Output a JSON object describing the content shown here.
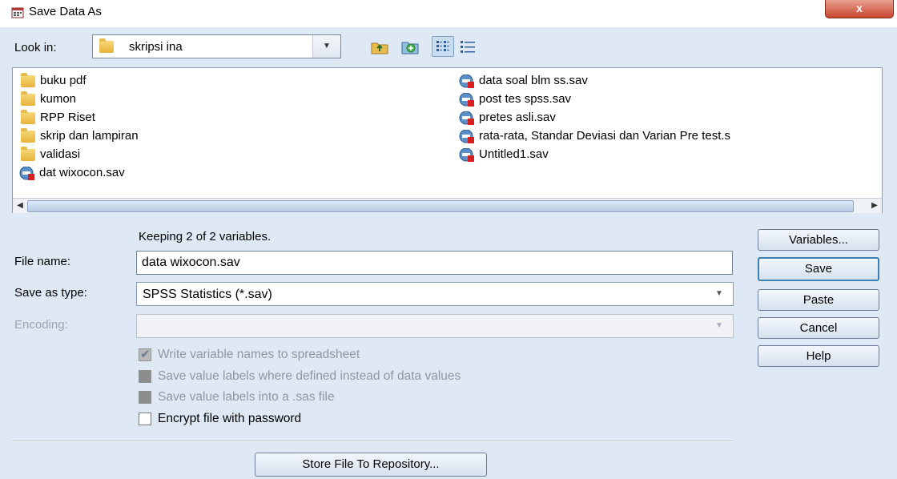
{
  "window": {
    "title": "Save Data As",
    "close_glyph": "x"
  },
  "lookin": {
    "label": "Look in:",
    "value": "skripsi ina"
  },
  "toolbar": [
    "up-one-level-icon",
    "new-folder-icon",
    "list-view-icon",
    "details-view-icon"
  ],
  "files_col1": [
    {
      "name": "buku pdf",
      "icon": "folder-icon"
    },
    {
      "name": "kumon",
      "icon": "folder-icon"
    },
    {
      "name": "RPP Riset",
      "icon": "folder-icon"
    },
    {
      "name": "skrip dan lampiran",
      "icon": "folder-icon"
    },
    {
      "name": "validasi",
      "icon": "folder-icon"
    },
    {
      "name": "dat wixocon.sav",
      "icon": "sav-file-icon"
    }
  ],
  "files_col2": [
    {
      "name": "data soal blm ss.sav",
      "icon": "sav-file-icon"
    },
    {
      "name": "post tes spss.sav",
      "icon": "sav-file-icon"
    },
    {
      "name": "pretes asli.sav",
      "icon": "sav-file-icon"
    },
    {
      "name": "rata-rata, Standar Deviasi dan Varian Pre test.s",
      "icon": "sav-file-icon"
    },
    {
      "name": "Untitled1.sav",
      "icon": "sav-file-icon"
    }
  ],
  "form": {
    "keeping": "Keeping 2 of 2 variables.",
    "file_name_label": "File name:",
    "file_name_value": "data wixocon.sav",
    "save_type_label": "Save as type:",
    "save_type_value": "SPSS Statistics (*.sav)",
    "encoding_label": "Encoding:",
    "encoding_value": ""
  },
  "options": [
    {
      "label": "Write variable names to spreadsheet",
      "state": "checked-disabled"
    },
    {
      "label": "Save value labels where defined instead of data values",
      "state": "disabled"
    },
    {
      "label": "Save value labels into a .sas file",
      "state": "disabled"
    },
    {
      "label": "Encrypt file with password",
      "state": "unchecked"
    }
  ],
  "buttons": {
    "variables": "Variables...",
    "save": "Save",
    "paste": "Paste",
    "cancel": "Cancel",
    "help": "Help",
    "store": "Store File To Repository..."
  },
  "colors": {
    "background": "#dfe9f5",
    "default_button_border": "#3c7fb1",
    "close_button": "#c8452f"
  }
}
